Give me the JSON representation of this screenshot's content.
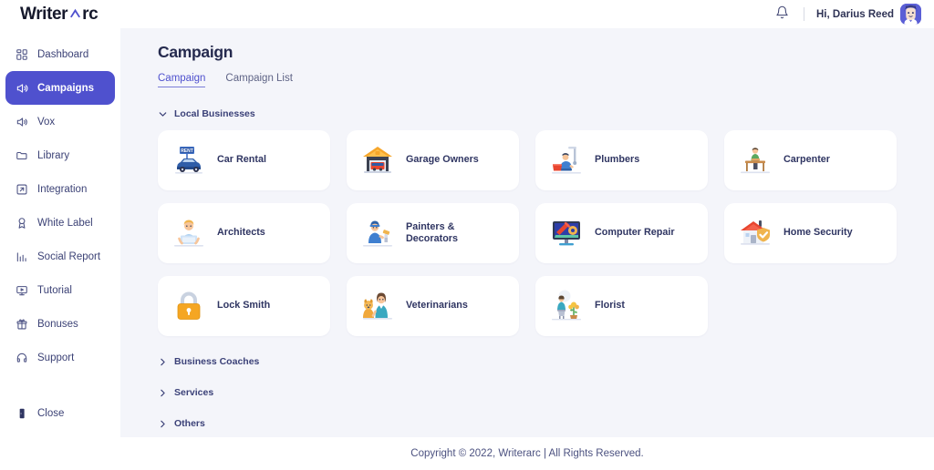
{
  "brand": {
    "name_part1": "Writer",
    "name_part2": "rc",
    "logo_icon": "arc-a-icon",
    "accent": "#4f51ce"
  },
  "topbar": {
    "bell_icon": "notification-bell-icon",
    "greeting": "Hi, Darius Reed",
    "avatar_icon": "user-avatar"
  },
  "sidebar": {
    "items": [
      {
        "label": "Dashboard",
        "icon": "dashboard-grid-icon",
        "active": false
      },
      {
        "label": "Campaigns",
        "icon": "megaphone-icon",
        "active": true
      },
      {
        "label": "Vox",
        "icon": "speaker-icon",
        "active": false
      },
      {
        "label": "Library",
        "icon": "folder-icon",
        "active": false
      },
      {
        "label": "Integration",
        "icon": "arrow-out-box-icon",
        "active": false
      },
      {
        "label": "White Label",
        "icon": "award-ribbon-icon",
        "active": false
      },
      {
        "label": "Social Report",
        "icon": "bar-chart-icon",
        "active": false
      },
      {
        "label": "Tutorial",
        "icon": "monitor-play-icon",
        "active": false
      },
      {
        "label": "Bonuses",
        "icon": "gift-box-icon",
        "active": false
      },
      {
        "label": "Support",
        "icon": "headset-icon",
        "active": false
      }
    ],
    "bottom": {
      "label": "Close",
      "icon": "door-close-icon"
    }
  },
  "main": {
    "page_title": "Campaign",
    "tabs": [
      {
        "label": "Campaign",
        "active": true
      },
      {
        "label": "Campaign List",
        "active": false
      }
    ],
    "sections": [
      {
        "title": "Local Businesses",
        "expanded": true,
        "chevron": "chevron-down-icon",
        "cards": [
          {
            "label": "Car Rental",
            "icon": "car-rental-icon"
          },
          {
            "label": "Garage Owners",
            "icon": "garage-icon"
          },
          {
            "label": "Plumbers",
            "icon": "plumber-icon"
          },
          {
            "label": "Carpenter",
            "icon": "carpenter-icon"
          },
          {
            "label": "Architects",
            "icon": "architect-icon"
          },
          {
            "label": "Painters & Decorators",
            "icon": "painter-icon"
          },
          {
            "label": "Computer Repair",
            "icon": "computer-repair-icon"
          },
          {
            "label": "Home Security",
            "icon": "home-security-icon"
          },
          {
            "label": "Lock Smith",
            "icon": "padlock-icon"
          },
          {
            "label": "Veterinarians",
            "icon": "veterinarian-icon"
          },
          {
            "label": "Florist",
            "icon": "florist-icon"
          }
        ]
      },
      {
        "title": "Business Coaches",
        "expanded": false,
        "chevron": "chevron-right-icon",
        "cards": []
      },
      {
        "title": "Services",
        "expanded": false,
        "chevron": "chevron-right-icon",
        "cards": []
      },
      {
        "title": "Others",
        "expanded": false,
        "chevron": "chevron-right-icon",
        "cards": []
      }
    ]
  },
  "footer": {
    "text": "Copyright © 2022, Writerarc | All Rights Reserved."
  }
}
